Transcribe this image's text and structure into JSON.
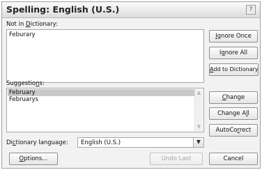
{
  "window": {
    "title": "Spelling: English (U.S.)",
    "help_glyph": "?"
  },
  "not_in_dictionary": {
    "label_pre": "Not in ",
    "label_key": "D",
    "label_post": "ictionary:",
    "value": "Feburary"
  },
  "suggestions": {
    "label_pre": "Suggestio",
    "label_key": "n",
    "label_post": "s:",
    "items": [
      "February",
      "Februarys"
    ],
    "selected_index": 0
  },
  "dictionary_language": {
    "label_pre": "Di",
    "label_key": "c",
    "label_post": "tionary language:",
    "value": "English (U.S.)"
  },
  "buttons": {
    "ignore_once": {
      "pre": "",
      "key": "I",
      "post": "gnore Once"
    },
    "ignore_all": {
      "pre": "I",
      "key": "g",
      "post": "nore All"
    },
    "add_to_dictionary": {
      "pre": "",
      "key": "A",
      "post": "dd to Dictionary"
    },
    "change": {
      "pre": "",
      "key": "C",
      "post": "hange"
    },
    "change_all": {
      "pre": "Change A",
      "key": "l",
      "post": "l"
    },
    "autocorrect": {
      "pre": "AutoCo",
      "key": "r",
      "post": "rect"
    },
    "options": {
      "pre": "",
      "key": "O",
      "post": "ptions..."
    },
    "undo_last": {
      "pre": "",
      "key": "",
      "post": "Undo Last"
    },
    "cancel": {
      "pre": "",
      "key": "",
      "post": "Cancel"
    }
  },
  "icons": {
    "scroll_up": "▲",
    "scroll_down": "▼",
    "dropdown": "▼"
  }
}
